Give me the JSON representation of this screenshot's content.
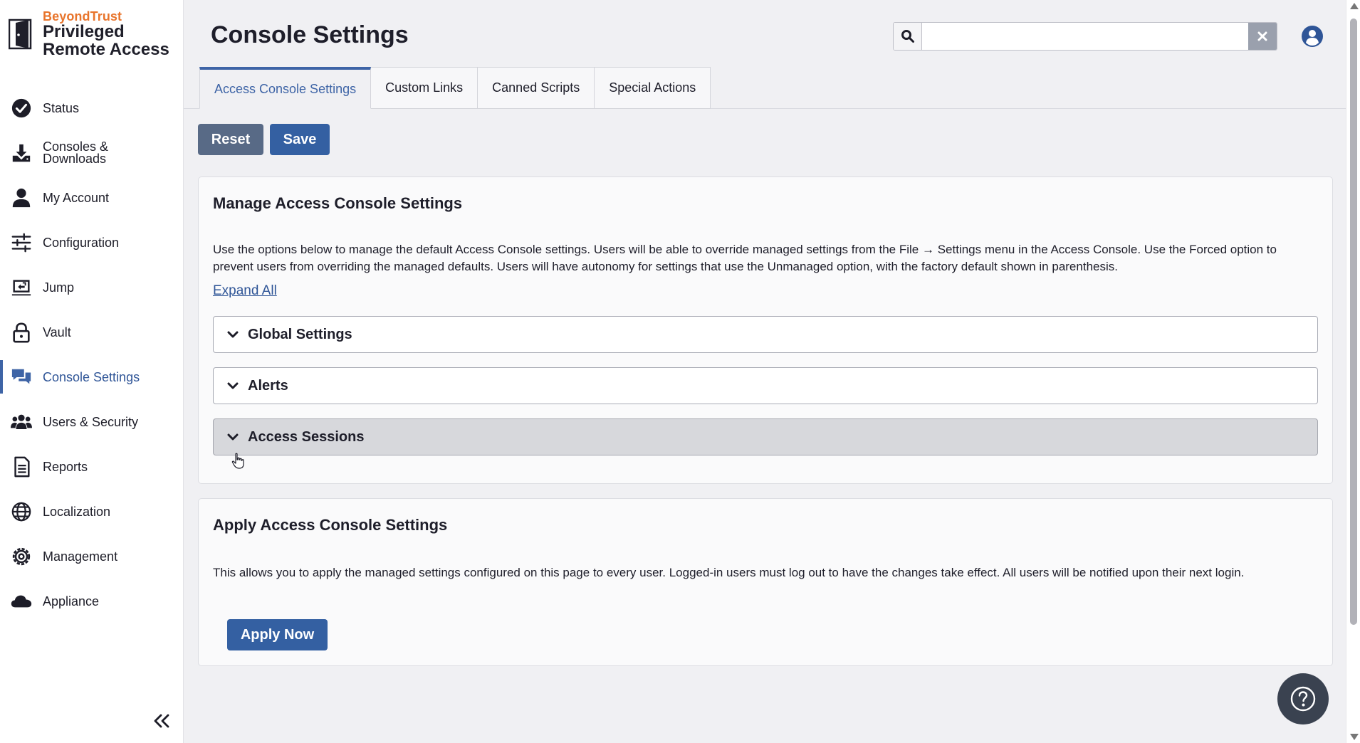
{
  "brand": {
    "company": "BeyondTrust",
    "product_line1": "Privileged",
    "product_line2": "Remote Access"
  },
  "sidebar": {
    "items": [
      {
        "label": "Status",
        "icon": "check-circle-icon"
      },
      {
        "label": "Consoles & Downloads",
        "icon": "download-icon"
      },
      {
        "label": "My Account",
        "icon": "user-icon"
      },
      {
        "label": "Configuration",
        "icon": "sliders-icon"
      },
      {
        "label": "Jump",
        "icon": "jump-icon"
      },
      {
        "label": "Vault",
        "icon": "lock-icon"
      },
      {
        "label": "Console Settings",
        "icon": "chat-icon",
        "active": true
      },
      {
        "label": "Users & Security",
        "icon": "users-icon"
      },
      {
        "label": "Reports",
        "icon": "report-icon"
      },
      {
        "label": "Localization",
        "icon": "globe-icon"
      },
      {
        "label": "Management",
        "icon": "gear-icon"
      },
      {
        "label": "Appliance",
        "icon": "cloud-icon"
      }
    ],
    "collapse_icon": "double-chevron-left-icon"
  },
  "header": {
    "title": "Console Settings",
    "search": {
      "value": "",
      "placeholder": ""
    }
  },
  "tabs": [
    {
      "label": "Access Console Settings",
      "active": true
    },
    {
      "label": "Custom Links"
    },
    {
      "label": "Canned Scripts"
    },
    {
      "label": "Special Actions"
    }
  ],
  "actions": {
    "reset_label": "Reset",
    "save_label": "Save"
  },
  "manage": {
    "title": "Manage Access Console Settings",
    "description": "Use the options below to manage the default Access Console settings. Users will be able to override managed settings from the File → Settings menu in the Access Console. Use the Forced option to prevent users from overriding the managed defaults. Users will have autonomy for settings that use the Unmanaged option, with the factory default shown in parenthesis.",
    "expand_all": "Expand All",
    "sections": [
      {
        "label": "Global Settings"
      },
      {
        "label": "Alerts"
      },
      {
        "label": "Access Sessions",
        "hovered": true
      }
    ]
  },
  "apply": {
    "title": "Apply Access Console Settings",
    "description": "This allows you to apply the managed settings configured on this page to every user. Logged-in users must log out to have the changes take effect. All users will be notified upon their next login.",
    "button_label": "Apply Now"
  },
  "colors": {
    "accent": "#3e64a6",
    "brand_orange": "#e8742b",
    "reset_button": "#586a86",
    "primary_button": "#3460a2"
  }
}
